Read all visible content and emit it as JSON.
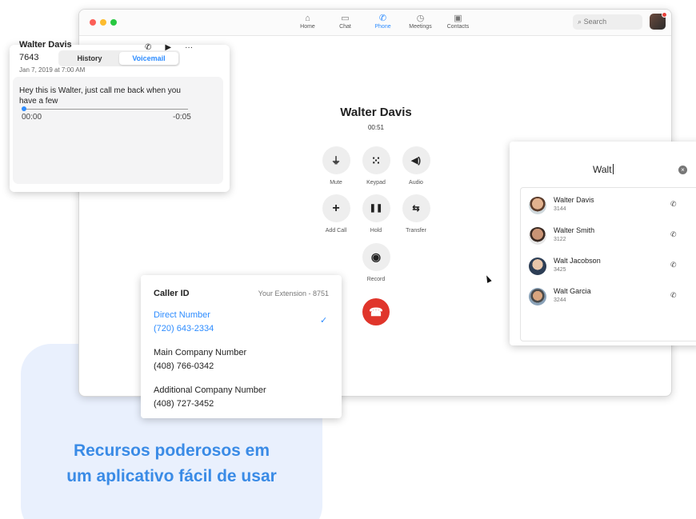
{
  "promo": {
    "line1": "Recursos poderosos em",
    "line2": "um aplicativo fácil de usar"
  },
  "app": {
    "nav": [
      {
        "label": "Home",
        "icon": "home-icon",
        "glyph": "⌂"
      },
      {
        "label": "Chat",
        "icon": "chat-icon",
        "glyph": "▭"
      },
      {
        "label": "Phone",
        "icon": "phone-icon",
        "glyph": "✆"
      },
      {
        "label": "Meetings",
        "icon": "clock-icon",
        "glyph": "◷"
      },
      {
        "label": "Contacts",
        "icon": "contacts-icon",
        "glyph": "▣"
      }
    ],
    "active_nav": "Phone",
    "search_placeholder": "Search"
  },
  "call": {
    "name": "Walter Davis",
    "duration": "00:51",
    "controls": [
      {
        "label": "Mute",
        "icon": "microphone-icon",
        "glyph": "🎙"
      },
      {
        "label": "Keypad",
        "icon": "keypad-icon",
        "glyph": "⠿"
      },
      {
        "label": "Audio",
        "icon": "speaker-icon",
        "glyph": "🔊"
      },
      {
        "label": "Add Call",
        "icon": "plus-icon",
        "glyph": "+"
      },
      {
        "label": "Hold",
        "icon": "pause-icon",
        "glyph": "❚❚"
      },
      {
        "label": "Transfer",
        "icon": "transfer-icon",
        "glyph": "⇆"
      },
      {
        "label": "Record",
        "icon": "record-icon",
        "glyph": "◉"
      }
    ]
  },
  "voicemail": {
    "tabs": [
      "History",
      "Voicemail"
    ],
    "active_tab": "Voicemail",
    "name": "Walter Davis",
    "extension": "7643",
    "date": "Jan 7, 2019 at 7:00 AM",
    "message": "Hey this is Walter, just call me back when you have a few",
    "time_elapsed": "00:00",
    "time_remaining": "-0:05",
    "progress": 0
  },
  "caller_id": {
    "title": "Caller ID",
    "extension": "Your Extension - 8751",
    "options": [
      {
        "name": "Direct Number",
        "number": "(720) 643-2334",
        "selected": true
      },
      {
        "name": "Main Company Number",
        "number": "(408) 766-0342",
        "selected": false
      },
      {
        "name": "Additional Company Number",
        "number": "(408) 727-3452",
        "selected": false
      }
    ]
  },
  "contacts_search": {
    "query": "Walt",
    "results": [
      {
        "name": "Walter Davis",
        "ext": "3144"
      },
      {
        "name": "Walter Smith",
        "ext": "3122"
      },
      {
        "name": "Walt Jacobson",
        "ext": "3425"
      },
      {
        "name": "Walt Garcia",
        "ext": "3244"
      }
    ]
  },
  "colors": {
    "accent": "#2d8cff",
    "hangup": "#e0352b",
    "promo_text": "#3a8be6",
    "promo_bg": "#e9f0fd"
  }
}
